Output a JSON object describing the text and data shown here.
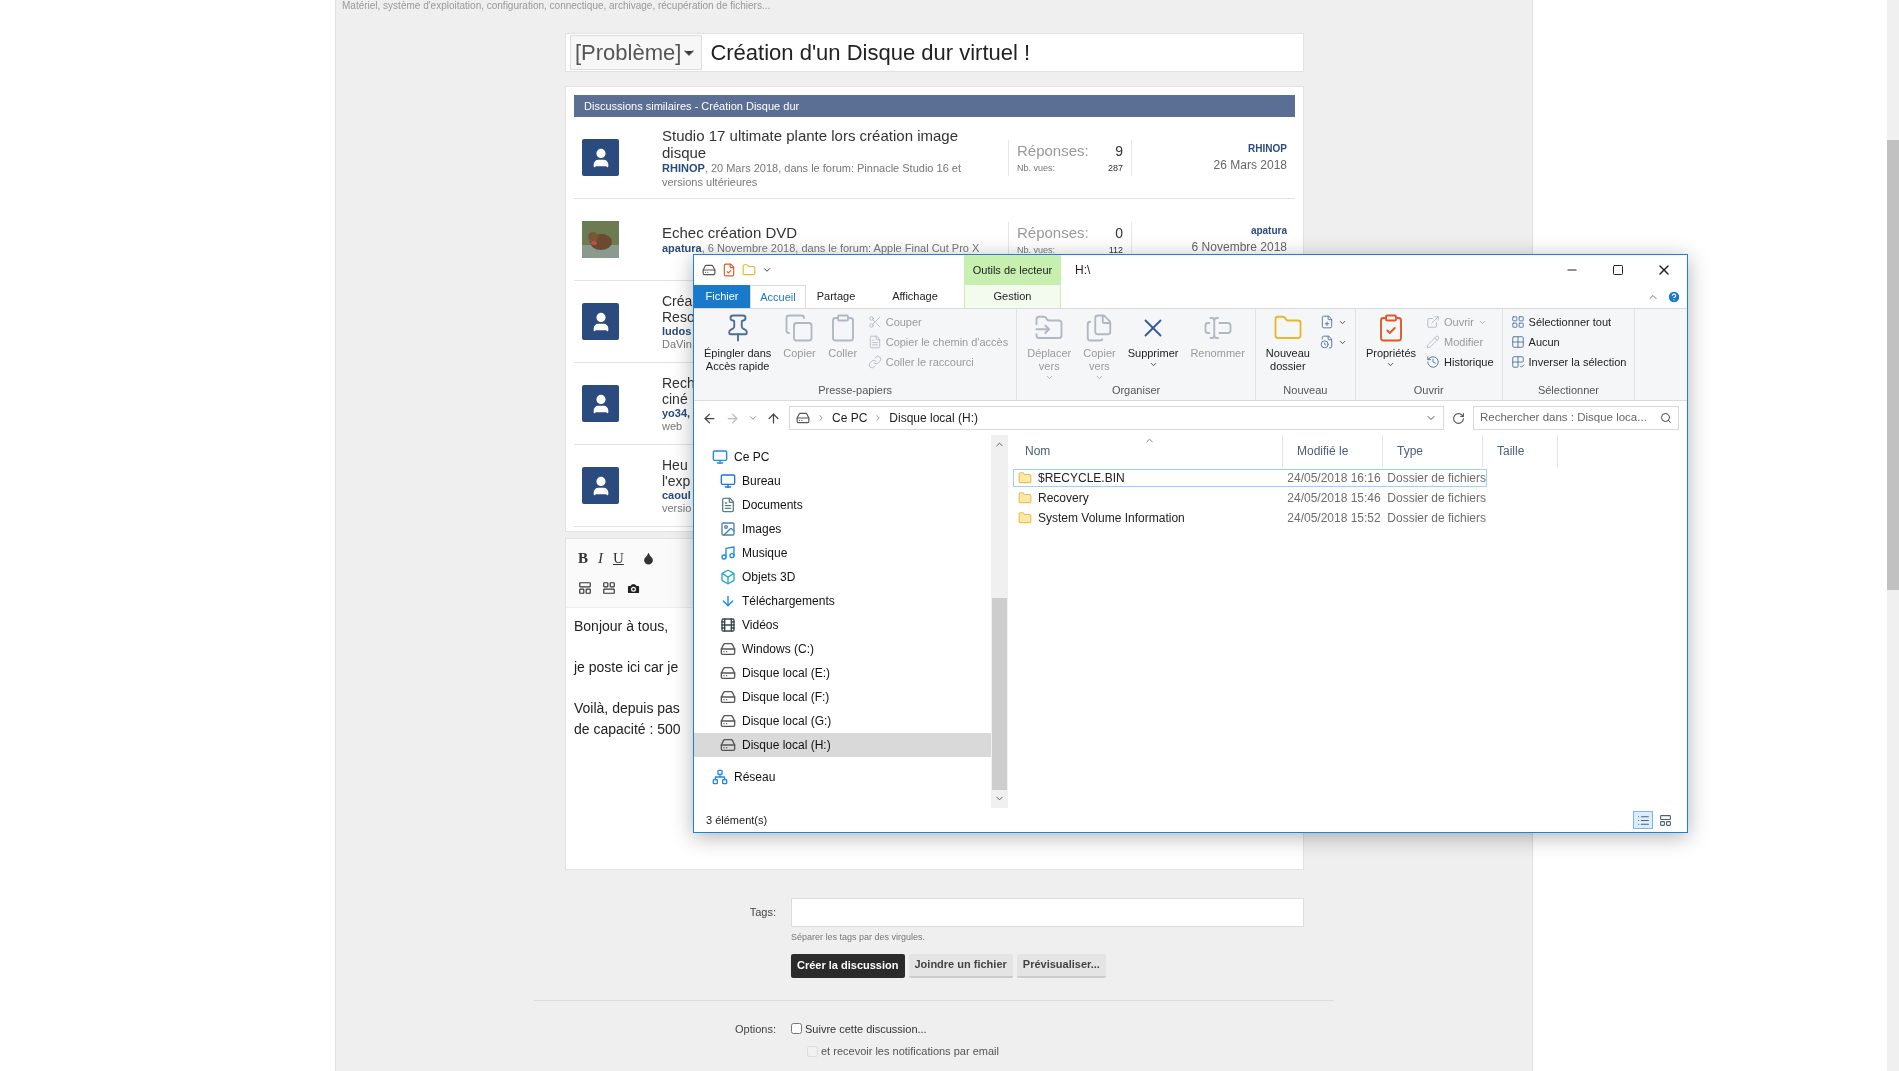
{
  "page_description": "Matériel, système d'exploitation, configuration, connectique, archivage, récupération de fichiers...",
  "thread": {
    "prefix": "[Problème]",
    "title": "Création d'un Disque dur virtuel !"
  },
  "similar_discussions": {
    "heading": "Discussions similaires - Création Disque dur",
    "rows": [
      {
        "kind": "full",
        "avatar": {
          "kind": "default"
        },
        "title": "Studio 17 ultimate plante lors création image disque",
        "author": "RHINOP",
        "meta": ", 20 Mars 2018, dans le forum: Pinnacle Studio 16 et versions ultérieures",
        "replies_label": "Réponses:",
        "replies": "9",
        "views_label": "Nb. vues:",
        "views": "287",
        "last_author": "RHINOP",
        "last_date": "26 Mars 2018"
      },
      {
        "kind": "full",
        "title": "Echec création DVD",
        "author": "apatura",
        "meta": ", 6 Novembre 2018, dans le forum: Apple Final Cut Pro X",
        "replies_label": "Réponses:",
        "replies": "0",
        "views_label": "Nb. vues:",
        "views": "112",
        "last_author": "apatura",
        "last_date": "6 Novembre 2018"
      },
      {
        "kind": "partial",
        "avatar": {
          "kind": "default"
        },
        "title_lines": [
          "Créa",
          "Reso"
        ],
        "author": "ludos",
        "meta": "DaVin"
      },
      {
        "kind": "partial",
        "avatar": {
          "kind": "default"
        },
        "title_lines": [
          "Rech",
          "ciné"
        ],
        "author": "yo34,",
        "meta": "web"
      },
      {
        "kind": "partial",
        "avatar": {
          "kind": "default"
        },
        "title_lines": [
          "Heu",
          "l'exp"
        ],
        "author": "caoul",
        "meta": "versio"
      }
    ]
  },
  "editor": {
    "format_buttons": [
      "B",
      "I",
      "U"
    ],
    "lines": [
      "Bonjour à tous,",
      "je poste ici car je",
      "Voilà, depuis pas",
      "de capacité : 500"
    ]
  },
  "tags": {
    "label": "Tags:",
    "hint": "Séparer les tags par des virgules."
  },
  "actions": [
    {
      "label": "Créer la discussion",
      "primary": true
    },
    {
      "label": "Joindre un fichier",
      "primary": false
    },
    {
      "label": "Prévisualiser...",
      "primary": false
    }
  ],
  "options": {
    "label": "Options:",
    "items": [
      {
        "label": "Suivre cette discussion...",
        "checked": false,
        "disabled": false
      },
      {
        "label": "et recevoir les notifications par email",
        "checked": false,
        "disabled": true
      }
    ]
  },
  "explorer": {
    "title": "H:\\",
    "context_group": "Outils de lecteur",
    "tabs": [
      {
        "label": "Fichier",
        "kind": "file",
        "selected": false
      },
      {
        "label": "Accueil",
        "kind": "tab",
        "selected": true
      },
      {
        "label": "Partage",
        "kind": "tab",
        "selected": false
      },
      {
        "label": "Affichage",
        "kind": "tab",
        "selected": false
      },
      {
        "label": "Gestion",
        "kind": "context",
        "selected": false
      }
    ],
    "ribbon_groups": [
      {
        "label": "Presse-papiers",
        "items": [
          {
            "kind": "large",
            "lines": [
              "Épingler dans",
              "Accès rapide"
            ],
            "menu": false,
            "disabled": false
          },
          {
            "kind": "large",
            "lines": [
              "Copier"
            ],
            "menu": false,
            "disabled": true
          },
          {
            "kind": "large",
            "lines": [
              "Coller"
            ],
            "menu": false,
            "disabled": true
          },
          {
            "kind": "stack",
            "items": [
              {
                "label": "Couper",
                "menu": false,
                "disabled": true
              },
              {
                "label": "Copier le chemin d'accès",
                "menu": false,
                "disabled": true
              },
              {
                "label": "Coller le raccourci",
                "menu": false,
                "disabled": true
              }
            ]
          }
        ]
      },
      {
        "label": "Organiser",
        "items": [
          {
            "kind": "large",
            "lines": [
              "Déplacer",
              "vers"
            ],
            "menu": true,
            "disabled": true
          },
          {
            "kind": "large",
            "lines": [
              "Copier",
              "vers"
            ],
            "menu": true,
            "disabled": true
          },
          {
            "kind": "large",
            "lines": [
              "Supprimer"
            ],
            "menu": true,
            "disabled": false
          },
          {
            "kind": "large",
            "lines": [
              "Renommer"
            ],
            "menu": false,
            "disabled": true
          }
        ]
      },
      {
        "label": "Nouveau",
        "items": [
          {
            "kind": "large",
            "lines": [
              "Nouveau",
              "dossier"
            ],
            "menu": false,
            "disabled": false
          },
          {
            "kind": "stack",
            "items": [
              {
                "menu": true,
                "disabled": false
              },
              {
                "menu": true,
                "disabled": false
              }
            ]
          }
        ]
      },
      {
        "label": "Ouvrir",
        "items": [
          {
            "kind": "large",
            "lines": [
              "Propriétés"
            ],
            "menu": true,
            "disabled": false
          },
          {
            "kind": "stack",
            "items": [
              {
                "label": "Ouvrir",
                "menu": true,
                "disabled": true
              },
              {
                "label": "Modifier",
                "menu": false,
                "disabled": true
              },
              {
                "label": "Historique",
                "menu": false,
                "disabled": false
              }
            ]
          }
        ]
      },
      {
        "label": "Sélectionner",
        "items": [
          {
            "kind": "stack",
            "items": [
              {
                "label": "Sélectionner tout",
                "menu": false,
                "disabled": false
              },
              {
                "label": "Aucun",
                "menu": false,
                "disabled": false
              },
              {
                "label": "Inverser la sélection",
                "menu": false,
                "disabled": false
              }
            ]
          }
        ]
      }
    ],
    "navigation": {
      "back_disabled": false,
      "forward_disabled": true
    },
    "address": {
      "segments": [
        "Ce PC",
        "Disque local (H:)"
      ],
      "search_placeholder": "Rechercher dans : Disque loca..."
    },
    "tree": [
      {
        "label": "Ce PC",
        "selected": false,
        "children": [
          {
            "label": "Bureau",
            "selected": false
          },
          {
            "label": "Documents",
            "selected": false
          },
          {
            "label": "Images",
            "selected": false
          },
          {
            "label": "Musique",
            "selected": false
          },
          {
            "label": "Objets 3D",
            "selected": false
          },
          {
            "label": "Téléchargements",
            "selected": false
          },
          {
            "label": "Vidéos",
            "selected": false
          },
          {
            "label": "Windows (C:)",
            "selected": false
          },
          {
            "label": "Disque local (E:)",
            "selected": false
          },
          {
            "label": "Disque local (F:)",
            "selected": false
          },
          {
            "label": "Disque local (G:)",
            "selected": false
          },
          {
            "label": "Disque local (H:)",
            "selected": true
          }
        ]
      },
      {
        "label": "Réseau",
        "selected": false
      }
    ],
    "columns": [
      "Nom",
      "Modifié le",
      "Type",
      "Taille"
    ],
    "files": [
      {
        "name": "$RECYCLE.BIN",
        "modified": "24/05/2018 16:16",
        "type": "Dossier de fichiers",
        "focused": true
      },
      {
        "name": "Recovery",
        "modified": "24/05/2018 15:46",
        "type": "Dossier de fichiers",
        "focused": false
      },
      {
        "name": "System Volume Information",
        "modified": "24/05/2018 15:52",
        "type": "Dossier de fichiers",
        "focused": false
      }
    ],
    "status": "3 élément(s)",
    "views": [
      {
        "kind": "details",
        "selected": true
      },
      {
        "kind": "tiles",
        "selected": false
      }
    ]
  }
}
